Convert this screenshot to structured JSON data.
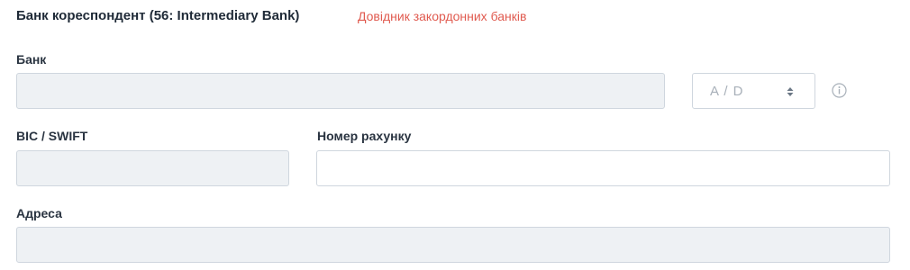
{
  "header": {
    "title": "Банк кореспондент (56: Intermediary Bank)",
    "link_label": "Довідник закордонних банків"
  },
  "bank": {
    "label": "Банк",
    "value": "",
    "select": {
      "selected": "A / D"
    }
  },
  "bic": {
    "label": "BIC / SWIFT",
    "value": ""
  },
  "account": {
    "label": "Номер рахунку",
    "value": ""
  },
  "address": {
    "label": "Адреса",
    "value": ""
  },
  "icons": {
    "info": "info-icon",
    "select_arrows": "chevron-up-down-icon"
  },
  "colors": {
    "link": "#e05a4f",
    "disabled_field": "#eef1f4",
    "border": "#cfd6de"
  }
}
